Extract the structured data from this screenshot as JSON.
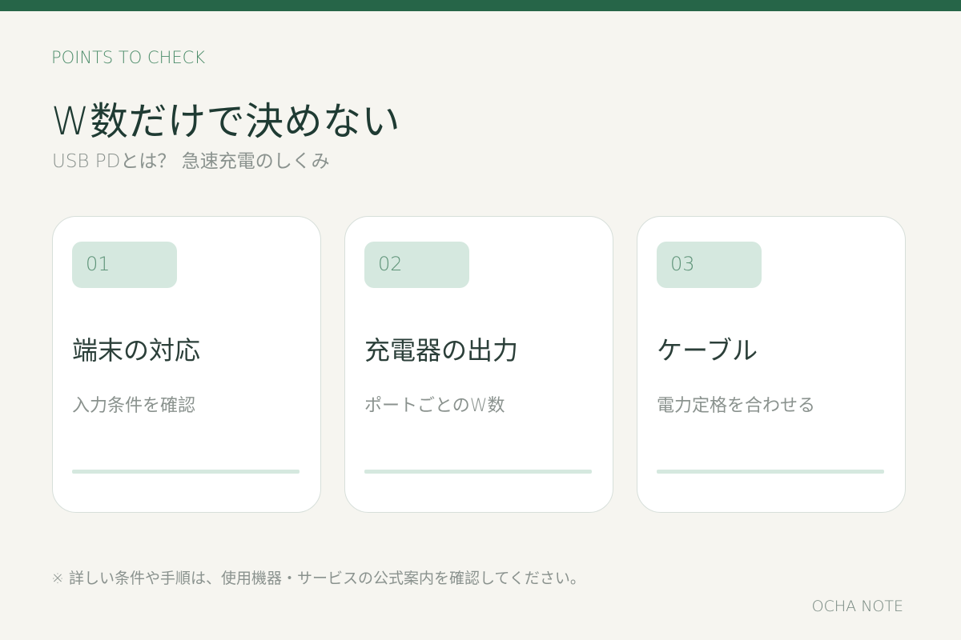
{
  "header": {
    "eyebrow": "POINTS TO CHECK",
    "title": "W数だけで決めない",
    "subtitle": "USB PDとは？ 急速充電のしくみ"
  },
  "cards": [
    {
      "number": "01",
      "title": "端末の対応",
      "description": "入力条件を確認"
    },
    {
      "number": "02",
      "title": "充電器の出力",
      "description": "ポートごとのW数"
    },
    {
      "number": "03",
      "title": "ケーブル",
      "description": "電力定格を合わせる"
    }
  ],
  "footer": {
    "note": "※ 詳しい条件や手順は、使用機器・サービスの公式案内を確認してください。",
    "brand": "OCHA NOTE"
  },
  "colors": {
    "accent": "#266548",
    "badge_bg": "#d5e8df",
    "background": "#f6f5f0"
  }
}
